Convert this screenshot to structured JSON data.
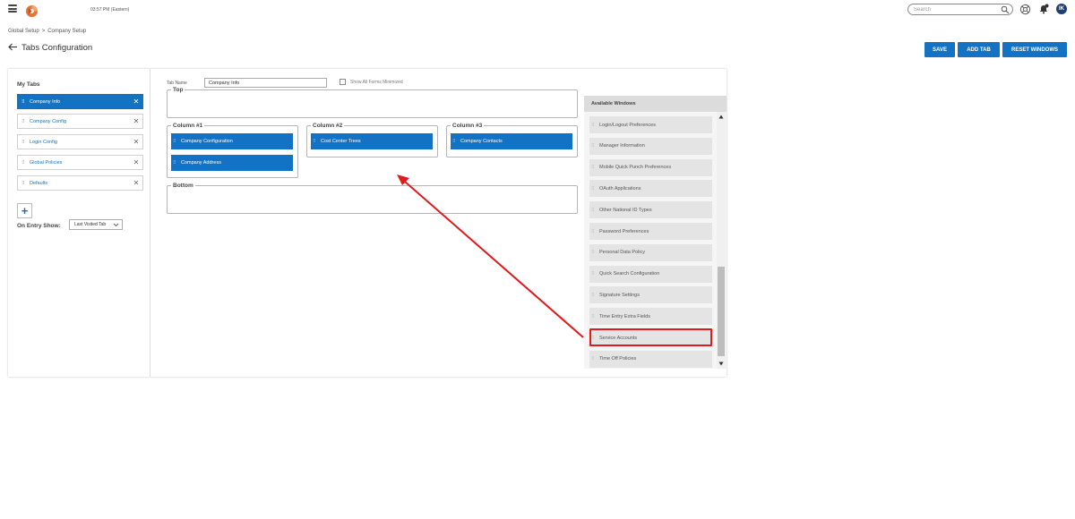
{
  "header": {
    "clock": "03:57 PM (Eastern)",
    "search_placeholder": "Search",
    "avatar_initials": "IK"
  },
  "breadcrumb": {
    "items": [
      "Global Setup",
      "Company Setup"
    ],
    "separator": ">"
  },
  "page": {
    "title": "Tabs Configuration"
  },
  "actions": {
    "save": "SAVE",
    "add_tab": "ADD TAB",
    "reset_windows": "RESET WINDOWS"
  },
  "my_tabs": {
    "title": "My Tabs",
    "items": [
      {
        "label": "Company Info",
        "active": true
      },
      {
        "label": "Company Config",
        "active": false
      },
      {
        "label": "Login Config",
        "active": false
      },
      {
        "label": "Global Policies",
        "active": false
      },
      {
        "label": "Defaults",
        "active": false
      }
    ],
    "on_entry_label": "On Entry Show:",
    "on_entry_value": "Last Visited Tab"
  },
  "editor": {
    "tab_name_label": "Tab Name",
    "tab_name_value": "Company Info",
    "show_minimized_label": "Show All Forms Minimized",
    "zones": {
      "top": "Top",
      "column1": "Column #1",
      "column2": "Column #2",
      "column3": "Column #3",
      "bottom": "Bottom"
    },
    "column1_windows": [
      "Company Configuration",
      "Company Address"
    ],
    "column2_windows": [
      "Cost Center Trees"
    ],
    "column3_windows": [
      "Company Contacts"
    ]
  },
  "available_windows": {
    "title": "Available Windows",
    "items": [
      "Login/Logout Preferences",
      "Manager Information",
      "Mobile Quick Punch Preferences",
      "OAuth Applications",
      "Other National ID Types",
      "Password Preferences",
      "Personal Data Policy",
      "Quick Search Configuration",
      "Signature Settings",
      "Time Entry Extra Fields",
      "Service Accounts",
      "Time Off Policies"
    ],
    "highlighted": "Service Accounts"
  },
  "colors": {
    "primary": "#1372c4",
    "highlight": "#e01b1b",
    "avatar": "#1e3f73"
  }
}
